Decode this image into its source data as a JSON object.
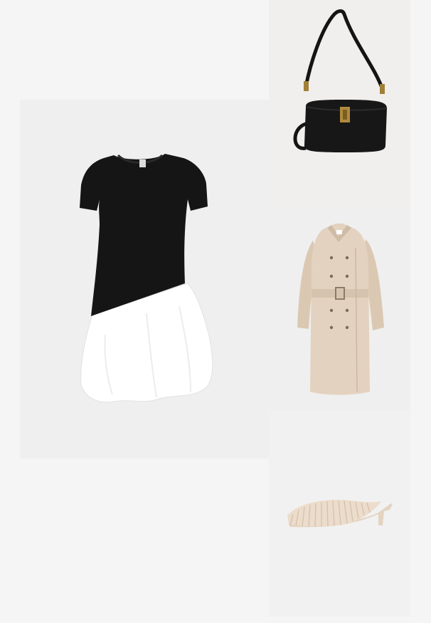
{
  "outfit": {
    "items": [
      {
        "product": "dress",
        "icon": "black-white-bubble-hem-dress-image",
        "colors": [
          "#141414",
          "#ffffff"
        ]
      },
      {
        "product": "bag",
        "icon": "black-leather-shoulder-bag-image",
        "colors": [
          "#161616",
          "#b08a3c"
        ]
      },
      {
        "product": "coat",
        "icon": "beige-trench-coat-image",
        "colors": [
          "#e3d2bf"
        ]
      },
      {
        "product": "shoe",
        "icon": "fringe-kitten-heel-mule-image",
        "colors": [
          "#ead9c8"
        ]
      }
    ]
  },
  "colors": {
    "page_background": "#f5f5f5",
    "tile_background": "#efefef"
  }
}
